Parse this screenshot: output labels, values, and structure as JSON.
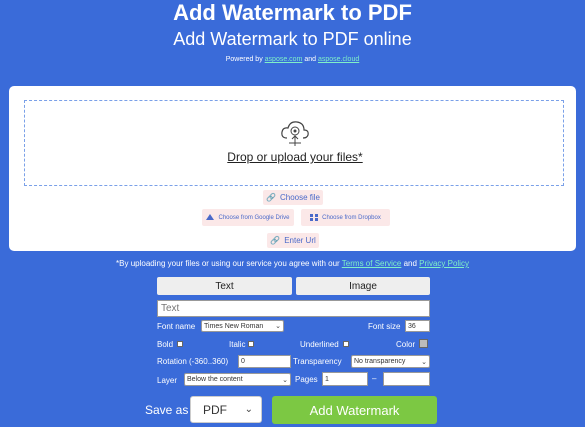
{
  "header": {
    "title": "Add Watermark to PDF",
    "subtitle": "Add Watermark to PDF online",
    "powered_prefix": "Powered by ",
    "powered_link1": "aspose.com",
    "powered_and": " and ",
    "powered_link2": "aspose.cloud"
  },
  "upload": {
    "drop_text": "Drop or upload your files*",
    "choose_file": "Choose file",
    "google_drive": "Choose from Google Drive",
    "dropbox": "Choose from Dropbox",
    "enter_url": "Enter Url"
  },
  "terms": {
    "prefix": "*By uploading your files or using our service you agree with our ",
    "tos": "Terms of Service",
    "and": " and ",
    "privacy": "Privacy Policy"
  },
  "tabs": {
    "text": "Text",
    "image": "Image"
  },
  "form": {
    "text_placeholder": "Text",
    "font_name_label": "Font name",
    "font_name_value": "Times New Roman",
    "font_size_label": "Font size",
    "font_size_value": "36",
    "bold_label": "Bold",
    "italic_label": "Italic",
    "underlined_label": "Underlined",
    "color_label": "Color",
    "rotation_label": "Rotation (-360..360)",
    "rotation_value": "0",
    "transparency_label": "Transparency",
    "transparency_value": "No transparency",
    "layer_label": "Layer",
    "layer_value": "Below the content",
    "pages_label": "Pages",
    "pages_from": "1",
    "pages_dash": "–",
    "pages_to": ""
  },
  "footer": {
    "save_as_label": "Save as",
    "save_as_value": "PDF",
    "add_button": "Add Watermark"
  }
}
